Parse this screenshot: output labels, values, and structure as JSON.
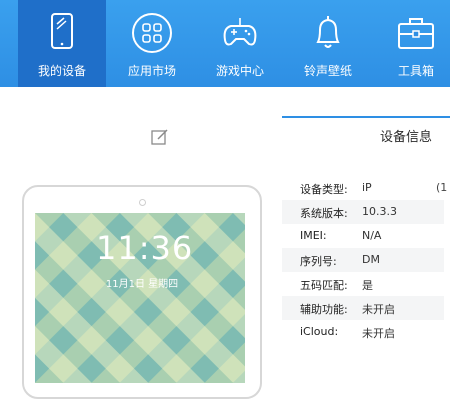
{
  "toolbar": {
    "tabs": [
      {
        "label": "我的设备",
        "icon": "tablet-icon",
        "active": true
      },
      {
        "label": "应用市场",
        "icon": "apps-grid-icon",
        "active": false
      },
      {
        "label": "游戏中心",
        "icon": "gamepad-icon",
        "active": false
      },
      {
        "label": "铃声壁纸",
        "icon": "bell-icon",
        "active": false
      },
      {
        "label": "工具箱",
        "icon": "toolbox-icon",
        "active": false
      }
    ]
  },
  "device_panel": {
    "edit_icon": "edit-icon",
    "lock_screen": {
      "time": "11:36",
      "date": "11月1日 星期四"
    }
  },
  "info_card": {
    "title": "设备信息",
    "rows": [
      {
        "key": "设备类型:",
        "value": "iP",
        "extra": "(1"
      },
      {
        "key": "系统版本:",
        "value": "10.3.3"
      },
      {
        "key": "IMEI:",
        "value": "N/A"
      },
      {
        "key": "序列号:",
        "value": "DM"
      },
      {
        "key": "五码匹配:",
        "value": "是"
      },
      {
        "key": "辅助功能:",
        "value": "未开启"
      },
      {
        "key": "iCloud:",
        "value": "未开启"
      }
    ]
  },
  "colors": {
    "accent": "#2e8fe4",
    "active_tab": "#1f6fc9"
  }
}
